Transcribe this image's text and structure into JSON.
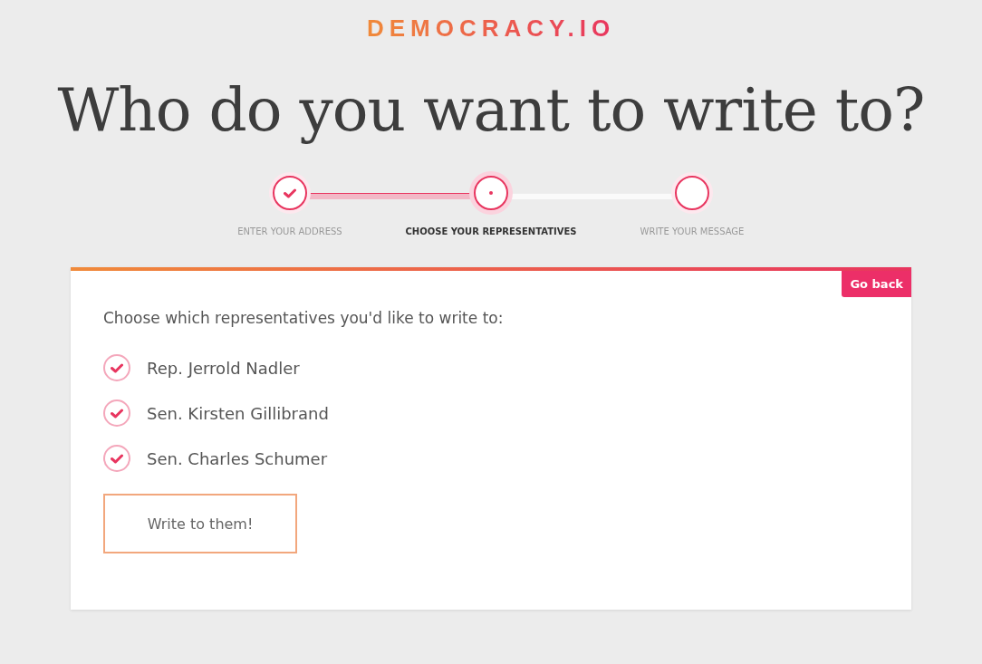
{
  "logo": "DEMOCRACY.IO",
  "title": "Who do you want to write to?",
  "steps": [
    {
      "label": "ENTER YOUR ADDRESS",
      "kind": "done",
      "selected": false
    },
    {
      "label": "CHOOSE YOUR REPRESENTATIVES",
      "kind": "current",
      "selected": true
    },
    {
      "label": "WRITE YOUR MESSAGE",
      "kind": "todo",
      "selected": false
    }
  ],
  "card": {
    "back_button": "Go back",
    "prompt": "Choose which representatives you'd like to write to:",
    "representatives": [
      {
        "name": "Rep. Jerrold Nadler",
        "checked": true
      },
      {
        "name": "Sen. Kirsten Gillibrand",
        "checked": true
      },
      {
        "name": "Sen. Charles Schumer",
        "checked": true
      }
    ],
    "submit_button": "Write to them!"
  }
}
